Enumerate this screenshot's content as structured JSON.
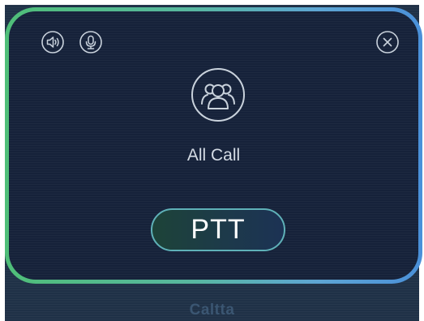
{
  "call_panel": {
    "group_name": "All Call",
    "ptt_label": "PTT",
    "icons": {
      "speaker": "speaker-icon",
      "microphone": "microphone-icon",
      "close": "close-icon",
      "group": "group-icon"
    }
  },
  "background": {
    "caption": "Caltta"
  },
  "colors": {
    "border_green": "#4fbe78",
    "border_blue": "#4a90d9",
    "panel_bg": "#16223a",
    "icon": "#c9d2dc",
    "text": "#d4dbe4"
  }
}
